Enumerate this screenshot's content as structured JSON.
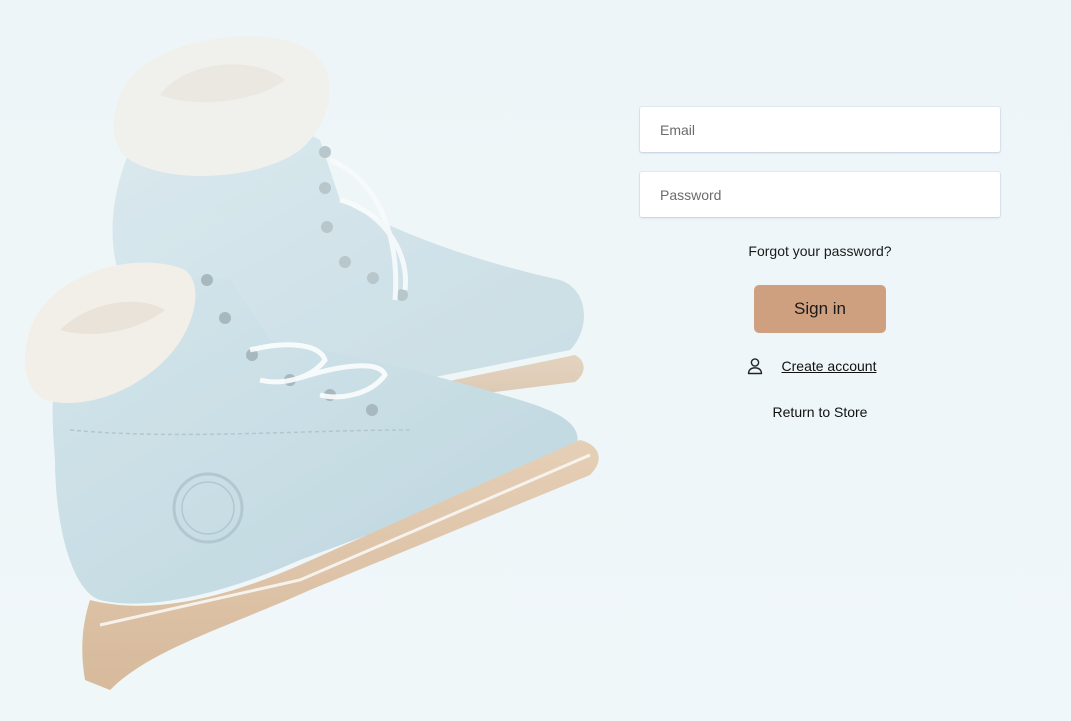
{
  "login": {
    "email_placeholder": "Email",
    "password_placeholder": "Password",
    "forgot_password": "Forgot your password?",
    "sign_in": "Sign in",
    "create_account": "Create account",
    "return_to_store": "Return to Store"
  },
  "icons": {
    "create_account_icon": "user-icon"
  },
  "colors": {
    "background": "#eef6f9",
    "sign_in_button": "#cfa080",
    "boot_leather": "#b9d4de",
    "boot_sole": "#d8b38e",
    "boot_fleece": "#f3ede3"
  }
}
